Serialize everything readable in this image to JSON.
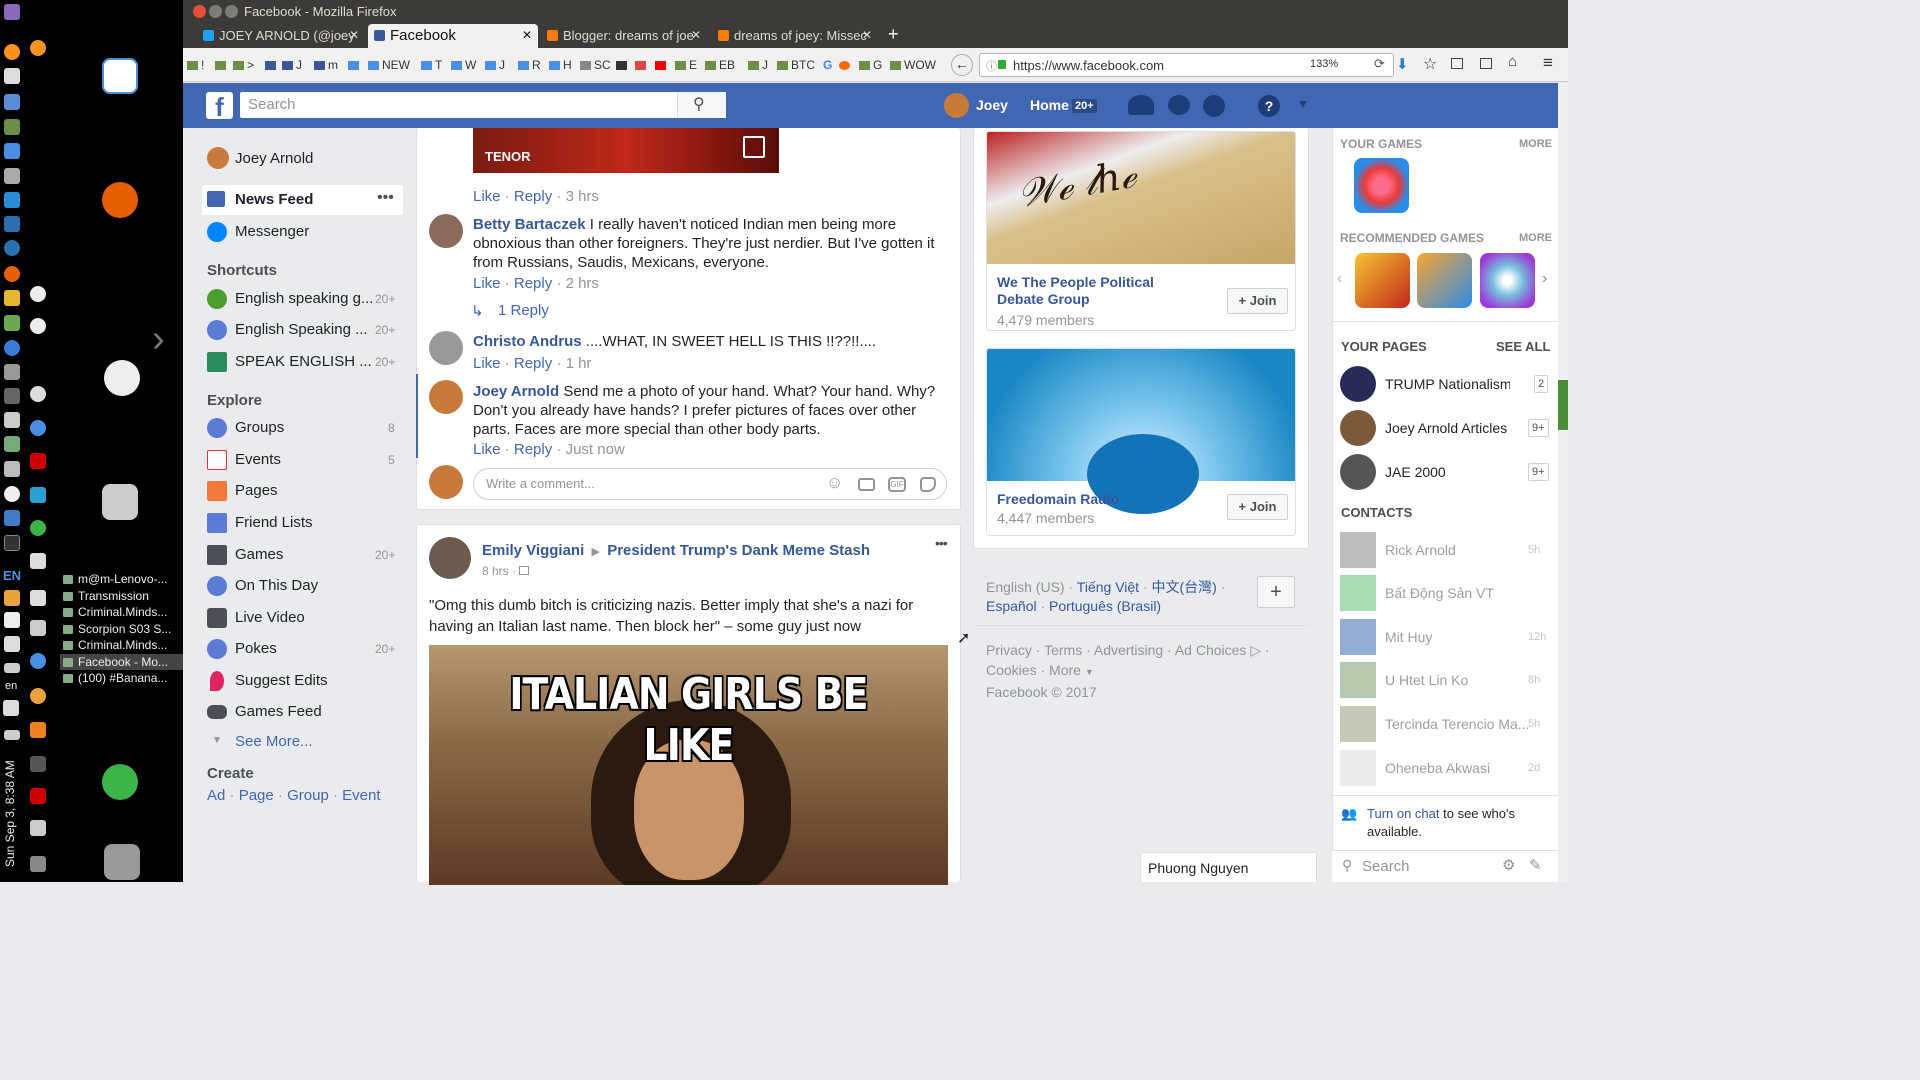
{
  "window": {
    "title": "Facebook - Mozilla Firefox"
  },
  "tabs": [
    {
      "label": "JOEY ARNOLD (@joey",
      "color": "#1da1f2"
    },
    {
      "label": "Facebook",
      "color": "#3b5998"
    },
    {
      "label": "Blogger: dreams of joe",
      "color": "#f57d00"
    },
    {
      "label": "dreams of joey: Missec",
      "color": "#f57d00"
    }
  ],
  "bookmarks": [
    "!",
    "",
    "",
    ">",
    "",
    "",
    "m",
    "",
    "NEW",
    "T",
    "W",
    "J",
    "R",
    "H",
    "SC",
    "",
    "",
    "E",
    "EB",
    "J",
    "BTC",
    "G",
    "",
    "G",
    "WOW"
  ],
  "url": {
    "text": "https://www.facebook.com",
    "zoom": "133%"
  },
  "desktop": {
    "clock": "Sun Sep 3, 8:38 AM",
    "lang": "EN",
    "lang_small": "en",
    "tasks": [
      "m@m-Lenovo-...",
      "Transmission",
      "Criminal.Minds...",
      "Scorpion S03 S...",
      "Criminal.Minds...",
      "Facebook - Mo...",
      "(100) #Banana..."
    ]
  },
  "fb": {
    "search_placeholder": "Search",
    "user": "Joey",
    "home": "Home",
    "home_count": "20+"
  },
  "leftnav": {
    "profile": "Joey Arnold",
    "news_feed": "News Feed",
    "messenger": "Messenger",
    "shortcuts_title": "Shortcuts",
    "shortcuts": [
      {
        "label": "English speaking g...",
        "count": "20+"
      },
      {
        "label": "English Speaking ...",
        "count": "20+"
      },
      {
        "label": "SPEAK ENGLISH ...",
        "count": "20+"
      }
    ],
    "explore_title": "Explore",
    "explore": [
      {
        "label": "Groups",
        "count": "8"
      },
      {
        "label": "Events",
        "count": "5"
      },
      {
        "label": "Pages",
        "count": ""
      },
      {
        "label": "Friend Lists",
        "count": ""
      },
      {
        "label": "Games",
        "count": "20+"
      },
      {
        "label": "On This Day",
        "count": ""
      },
      {
        "label": "Live Video",
        "count": ""
      },
      {
        "label": "Pokes",
        "count": "20+"
      },
      {
        "label": "Suggest Edits",
        "count": ""
      },
      {
        "label": "Games Feed",
        "count": ""
      }
    ],
    "see_more": "See More...",
    "create_title": "Create",
    "create": [
      "Ad",
      "Page",
      "Group",
      "Event"
    ]
  },
  "feed": {
    "gif_label": "TENOR",
    "actions_1": {
      "like": "Like",
      "reply": "Reply",
      "time": "3 hrs"
    },
    "comments": [
      {
        "author": "Betty Bartaczek",
        "text": "I really haven't noticed Indian men being more obnoxious than other foreigners. They're just nerdier. But I've gotten it from Russians, Saudis, Mexicans, everyone.",
        "like": "Like",
        "reply": "Reply",
        "time": "2 hrs"
      },
      {
        "author": "Christo Andrus",
        "text": "....WHAT, IN SWEET HELL IS THIS !!??!!....",
        "like": "Like",
        "reply": "Reply",
        "time": "1 hr"
      },
      {
        "author": "Joey Arnold",
        "text": "Send me a photo of your hand. What? Your hand. Why? Don't you already have hands? I prefer pictures of faces over other parts. Faces are more special than other body parts.",
        "like": "Like",
        "reply": "Reply",
        "time": "Just now"
      }
    ],
    "replies_link": "1 Reply",
    "comment_placeholder": "Write a comment...",
    "post": {
      "author": "Emily Viggiani",
      "group": "President Trump's Dank Meme Stash",
      "time": "8 hrs",
      "text": "\"Omg this dumb bitch is criticizing nazis. Better imply that she's a nazi for having an Italian last name. Then block her\" – some guy just now",
      "meme_caption": "ITALIAN GIRLS BE LIKE"
    }
  },
  "suggested": [
    {
      "name": "We The People Political Debate Group",
      "members": "4,479 members",
      "join": "Join"
    },
    {
      "name": "Freedomain Radio",
      "members": "4,447 members",
      "join": "Join"
    }
  ],
  "languages": {
    "current": "English (US)",
    "others": [
      "Tiếng Việt",
      "中文(台灣)",
      "Español",
      "Português (Brasil)"
    ]
  },
  "footer": {
    "links": [
      "Privacy",
      "Terms",
      "Advertising",
      "Ad Choices",
      "Cookies",
      "More"
    ],
    "copyright": "Facebook © 2017"
  },
  "rightcol": {
    "games_title": "YOUR GAMES",
    "more": "MORE",
    "rec_title": "RECOMMENDED GAMES",
    "pages_title": "YOUR PAGES",
    "see_all": "SEE ALL",
    "pages": [
      {
        "name": "TRUMP Nationalism ...",
        "count": "2"
      },
      {
        "name": "Joey Arnold Articles",
        "count": "9+"
      },
      {
        "name": "JAE 2000",
        "count": "9+"
      }
    ],
    "contacts_title": "CONTACTS",
    "contacts": [
      {
        "name": "Rick Arnold",
        "time": "5h"
      },
      {
        "name": "Bất Động Sản VT",
        "time": ""
      },
      {
        "name": "Mit Huy",
        "time": "12h"
      },
      {
        "name": "U Htet Lin Ko",
        "time": "8h"
      },
      {
        "name": "Tercinda Terencio Ma...",
        "time": "5h"
      },
      {
        "name": "Oheneba Akwasi",
        "time": "2d"
      }
    ],
    "chat_link": "Turn on chat",
    "chat_text": " to see who's available.",
    "chat_search": "Search",
    "chat_tab": "Phuong Nguyen"
  }
}
